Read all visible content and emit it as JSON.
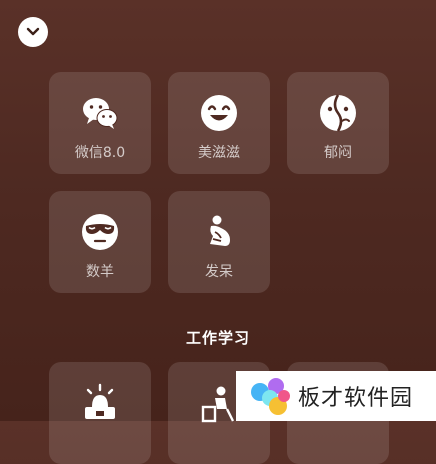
{
  "colors": {
    "background_top": "#5a3128",
    "background_bottom": "#46231b",
    "tile_bg": "rgba(255,255,255,0.12)",
    "icon": "#ffffff"
  },
  "header": {
    "collapse_icon": "chevron-down-icon"
  },
  "tiles": [
    {
      "label": "微信8.0",
      "icon": "wechat-icon"
    },
    {
      "label": "美滋滋",
      "icon": "smile-icon"
    },
    {
      "label": "郁闷",
      "icon": "gloomy-face-icon"
    },
    {
      "label": "数羊",
      "icon": "sleep-mask-icon"
    },
    {
      "label": "发呆",
      "icon": "daze-icon"
    }
  ],
  "sections": {
    "work_study": {
      "title": "工作学习",
      "tiles": [
        {
          "icon": "alarm-laptop-icon"
        },
        {
          "icon": "desk-study-icon"
        },
        {
          "icon": ""
        }
      ]
    }
  },
  "watermark": {
    "text": "板才软件园"
  }
}
